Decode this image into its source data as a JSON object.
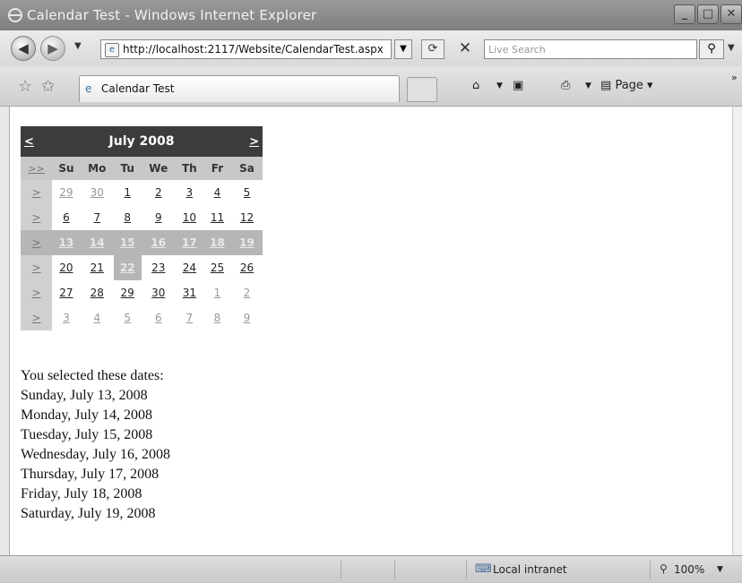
{
  "window": {
    "title": "Calendar Test - Windows Internet Explorer"
  },
  "nav": {
    "url": "http://localhost:2117/Website/CalendarTest.aspx",
    "search_placeholder": "Live Search"
  },
  "tabs": [
    {
      "label": "Calendar Test"
    }
  ],
  "commands": {
    "page_label": "Page"
  },
  "calendar": {
    "prev": "<",
    "next": ">",
    "month_title": "July 2008",
    "select_month": ">>",
    "select_week": ">",
    "days_of_week": [
      "Su",
      "Mo",
      "Tu",
      "We",
      "Th",
      "Fr",
      "Sa"
    ],
    "weeks": [
      [
        "29",
        "30",
        "1",
        "2",
        "3",
        "4",
        "5"
      ],
      [
        "6",
        "7",
        "8",
        "9",
        "10",
        "11",
        "12"
      ],
      [
        "13",
        "14",
        "15",
        "16",
        "17",
        "18",
        "19"
      ],
      [
        "20",
        "21",
        "22",
        "23",
        "24",
        "25",
        "26"
      ],
      [
        "27",
        "28",
        "29",
        "30",
        "31",
        "1",
        "2"
      ],
      [
        "3",
        "4",
        "5",
        "6",
        "7",
        "8",
        "9"
      ]
    ]
  },
  "selection": {
    "heading": "You selected these dates:",
    "dates": [
      "Sunday, July 13, 2008",
      "Monday, July 14, 2008",
      "Tuesday, July 15, 2008",
      "Wednesday, July 16, 2008",
      "Thursday, July 17, 2008",
      "Friday, July 18, 2008",
      "Saturday, July 19, 2008"
    ]
  },
  "status": {
    "zone": "Local intranet",
    "zoom": "100%"
  }
}
